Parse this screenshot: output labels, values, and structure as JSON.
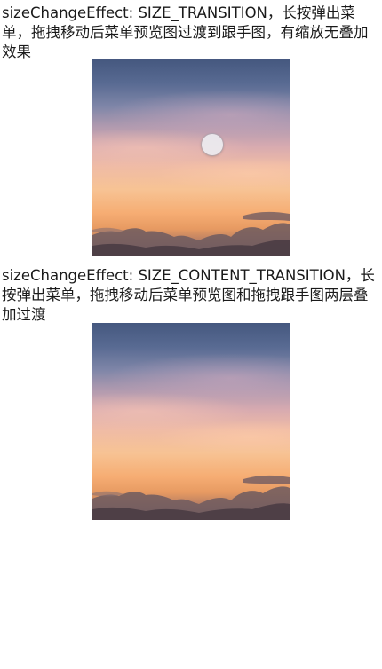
{
  "sections": [
    {
      "description": "sizeChangeEffect: SIZE_TRANSITION，长按弹出菜单，拖拽移动后菜单预览图过渡到跟手图，有缩放无叠加效果"
    },
    {
      "description": "sizeChangeEffect: SIZE_CONTENT_TRANSITION，长按弹出菜单，拖拽移动后菜单预览图和拖拽跟手图两层叠加过渡"
    }
  ],
  "colors": {
    "sky_top": "#45587f",
    "sky_middle": "#efbba6",
    "sky_bottom": "#f6ad73",
    "touch_indicator": "#ebebf0"
  },
  "icons": {
    "touch_point": "touch-point-icon"
  }
}
